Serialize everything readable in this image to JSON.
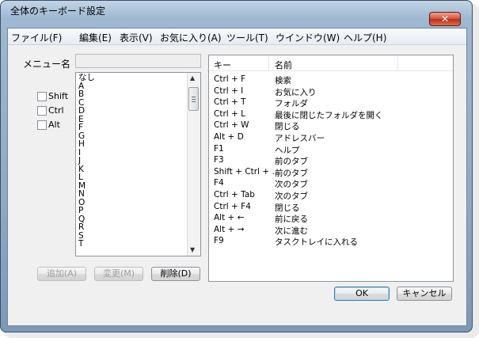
{
  "window": {
    "title": "全体のキーボード設定",
    "close_glyph": "✕"
  },
  "menu": [
    "ファイル(F)",
    "編集(E)",
    "表示(V)",
    "お気に入り(A)",
    "ツール(T)",
    "ウインドウ(W)",
    "ヘルプ(H)"
  ],
  "name_label": "メニュー名",
  "name_value": "",
  "modifiers": [
    {
      "label": "Shift",
      "checked": false
    },
    {
      "label": "Ctrl",
      "checked": false
    },
    {
      "label": "Alt",
      "checked": false
    }
  ],
  "key_list": [
    "なし",
    "A",
    "B",
    "C",
    "D",
    "E",
    "F",
    "G",
    "H",
    "I",
    "J",
    "K",
    "L",
    "M",
    "N",
    "O",
    "P",
    "Q",
    "R",
    "S",
    "T"
  ],
  "buttons": {
    "add": "追加(A)",
    "change": "変更(M)",
    "delete": "削除(D)",
    "ok": "OK",
    "cancel": "キャンセル"
  },
  "table": {
    "headers": [
      "キー",
      "名前"
    ],
    "rows": [
      [
        "Ctrl + F",
        "検索"
      ],
      [
        "Ctrl + I",
        "お気に入り"
      ],
      [
        "Ctrl + T",
        "フォルダ"
      ],
      [
        "Ctrl + L",
        "最後に閉じたフォルダを開く"
      ],
      [
        "Ctrl + W",
        "閉じる"
      ],
      [
        "Alt + D",
        "アドレスバー"
      ],
      [
        "F1",
        "ヘルプ"
      ],
      [
        "F3",
        "前のタブ"
      ],
      [
        "Shift + Ctrl + ...",
        "前のタブ"
      ],
      [
        "F4",
        "次のタブ"
      ],
      [
        "Ctrl + Tab",
        "次のタブ"
      ],
      [
        "Ctrl + F4",
        "閉じる"
      ],
      [
        "Alt + ←",
        "前に戻る"
      ],
      [
        "Alt + →",
        "次に進む"
      ],
      [
        "F9",
        "タスクトレイに入れる"
      ]
    ]
  },
  "scroll_up_glyph": "▲",
  "scroll_down_glyph": "▼"
}
